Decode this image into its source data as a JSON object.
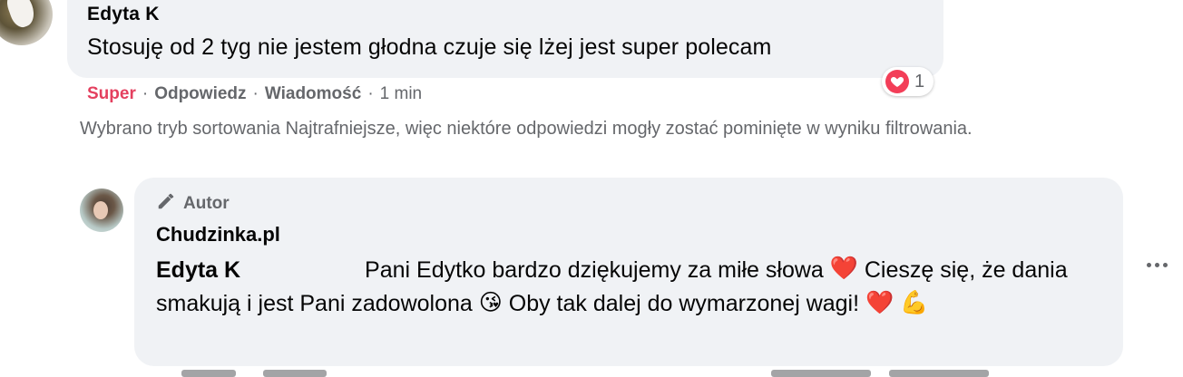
{
  "comment": {
    "author": "Edyta K",
    "text": "Stosuję od 2 tyg nie jestem głodna czuje się lżej jest super polecam",
    "reaction_count": "1",
    "reaction_icon": "heart-icon",
    "actions": {
      "super": "Super",
      "reply": "Odpowiedz",
      "message": "Wiadomość",
      "time": "1 min"
    },
    "separator": "·"
  },
  "sort_notice": "Wybrano tryb sortowania Najtrafniejsze, więc niektóre odpowiedzi mogły zostać pominięte w wyniku filtrowania.",
  "reply": {
    "author_badge": "Autor",
    "author": "Chudzinka.pl",
    "mention": "Edyta K",
    "text_part1": " Pani Edytko bardzo dziękujemy za miłe słowa ",
    "text_part2": " Cieszę się, że dania smakują i jest Pani zadowolona ",
    "text_part3": " Oby tak dalej do wymarzonej wagi! ",
    "emoji_heart": "❤️",
    "emoji_kiss": "😘",
    "emoji_muscle": "💪"
  },
  "colors": {
    "bubble": "#f0f2f5",
    "secondary_text": "#65676b",
    "super_red": "#e4405f",
    "heart_red": "#f33e58"
  }
}
